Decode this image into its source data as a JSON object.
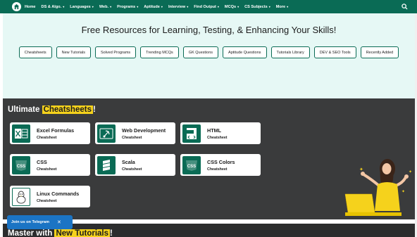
{
  "nav": {
    "items": [
      {
        "label": "Home",
        "caret": false
      },
      {
        "label": "DS & Algo.",
        "caret": true
      },
      {
        "label": "Languages",
        "caret": true
      },
      {
        "label": "Web.",
        "caret": true
      },
      {
        "label": "Programs",
        "caret": true
      },
      {
        "label": "Aptitude",
        "caret": true
      },
      {
        "label": "Interview",
        "caret": true
      },
      {
        "label": "Find Output",
        "caret": true
      },
      {
        "label": "MCQs",
        "caret": true
      },
      {
        "label": "CS Subjects",
        "caret": true
      },
      {
        "label": "More",
        "caret": true
      }
    ],
    "caret_glyph": "▾"
  },
  "hero": {
    "title": "Free Resources for Learning, Testing, & Enhancing Your Skills!",
    "chips": [
      "Cheatsheets",
      "New Tutorials",
      "Solved Programs",
      "Trending MCQs",
      "GK Questions",
      "Aptitude Questions",
      "Tutorials Library",
      "DEV & SEO Tools",
      "Recently Added"
    ]
  },
  "cheatsheets": {
    "heading_prefix": "Ultimate ",
    "heading_highlight": "Cheatsheets",
    "heading_suffix": "!",
    "cards": [
      {
        "title": "Excel Formulas",
        "sub": "Cheatsheet",
        "icon": "excel-icon"
      },
      {
        "title": "Web Development",
        "sub": "Cheatsheet",
        "icon": "rocket-icon"
      },
      {
        "title": "HTML",
        "sub": "Cheatsheet",
        "icon": "html-file-icon"
      },
      {
        "title": "CSS",
        "sub": "Cheatsheet",
        "icon": "css-icon"
      },
      {
        "title": "Scala",
        "sub": "Cheatsheet",
        "icon": "scala-icon"
      },
      {
        "title": "CSS Colors",
        "sub": "Cheatsheet",
        "icon": "css-colors-icon"
      },
      {
        "title": "Linux Commands",
        "sub": "Cheatsheet",
        "icon": "linux-icon"
      }
    ]
  },
  "tutorials": {
    "heading_prefix": "Master with ",
    "heading_highlight": "New Tutorials",
    "heading_suffix": "!"
  },
  "telegram": {
    "label": "Join us on Telegram",
    "close": "✕"
  },
  "icon_glyphs": {
    "css_text": "CSS"
  },
  "colors": {
    "brand": "#0a6b55",
    "highlight": "#f5d21c",
    "dark_bg": "#3a3b3c",
    "telegram": "#1b74c4"
  }
}
